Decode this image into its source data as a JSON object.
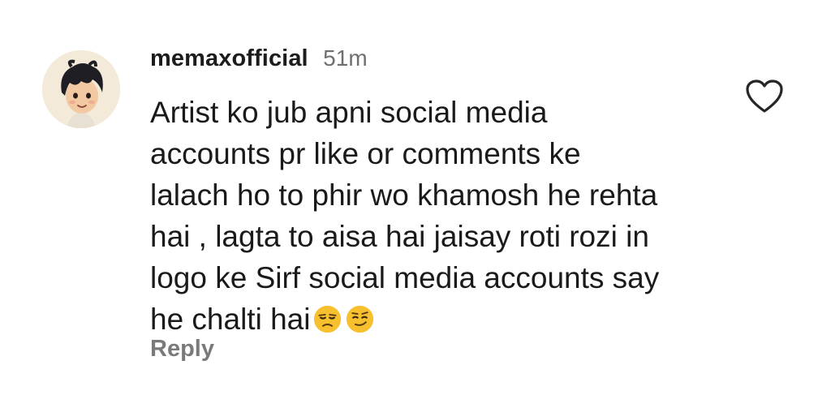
{
  "comment": {
    "username": "memaxofficial",
    "timestamp": "51m",
    "text": "Artist ko jub apni social media\naccounts pr like or comments ke\nlalach ho to phir wo khamosh he rehta\nhai , lagta to aisa hai jaisay roti rozi in\nlogo ke Sirf social media accounts say\nhe chalti hai",
    "emojis": [
      "unamused-face-icon",
      "smirking-face-icon"
    ],
    "reply_label": "Reply",
    "like_icon": "heart-outline-icon"
  },
  "colors": {
    "username": "#1c1c1c",
    "timestamp": "#6f6f6f",
    "reply": "#7a7a7a",
    "emoji_fill": "#f6c02f"
  }
}
